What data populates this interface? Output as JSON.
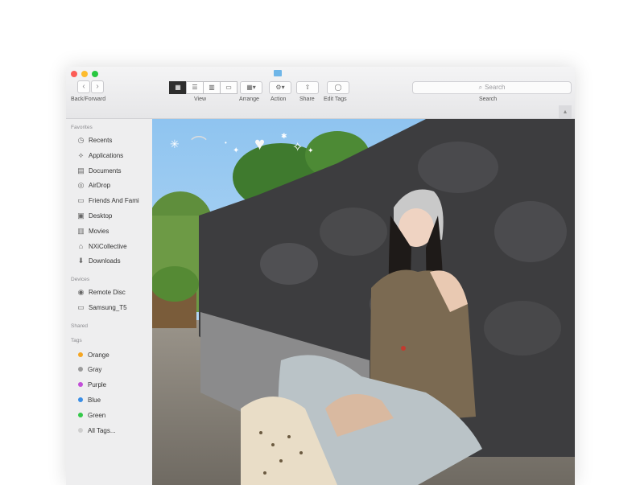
{
  "toolbar": {
    "back_forward_label": "Back/Forward",
    "view_label": "View",
    "arrange_label": "Arrange",
    "action_label": "Action",
    "share_label": "Share",
    "edit_tags_label": "Edit Tags",
    "search_placeholder": "Search",
    "search_label": "Search"
  },
  "sidebar": {
    "favorites_title": "Favorites",
    "favorites": [
      {
        "label": "Recents",
        "icon": "clock-icon"
      },
      {
        "label": "Applications",
        "icon": "applications-icon"
      },
      {
        "label": "Documents",
        "icon": "document-icon"
      },
      {
        "label": "AirDrop",
        "icon": "airdrop-icon"
      },
      {
        "label": "Friends And Fami",
        "icon": "folder-icon"
      },
      {
        "label": "Desktop",
        "icon": "desktop-icon"
      },
      {
        "label": "Movies",
        "icon": "film-icon"
      },
      {
        "label": "NXiCollective",
        "icon": "house-icon"
      },
      {
        "label": "Downloads",
        "icon": "download-icon"
      }
    ],
    "devices_title": "Devices",
    "devices": [
      {
        "label": "Remote Disc",
        "icon": "disc-icon"
      },
      {
        "label": "Samsung_T5",
        "icon": "drive-icon"
      }
    ],
    "shared_title": "Shared",
    "tags_title": "Tags",
    "tags": [
      {
        "label": "Orange",
        "color": "#f5a623"
      },
      {
        "label": "Gray",
        "color": "#9b9b9b"
      },
      {
        "label": "Purple",
        "color": "#c24fd8"
      },
      {
        "label": "Blue",
        "color": "#3a8ee6"
      },
      {
        "label": "Green",
        "color": "#34c84a"
      },
      {
        "label": "All Tags...",
        "color": "#cfcfcf"
      }
    ]
  }
}
